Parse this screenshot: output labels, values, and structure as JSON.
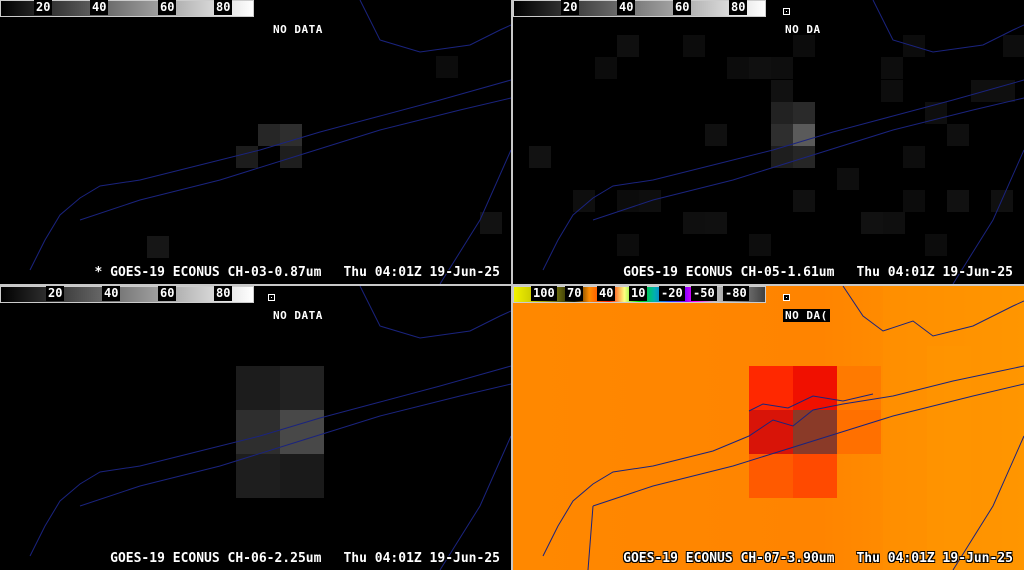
{
  "panels": [
    {
      "channel_caption": "* GOES-19 ECONUS CH-03-0.87um",
      "time_caption": "Thu 04:01Z 19-Jun-25",
      "no_data": "NO DATA",
      "colorbar_ticks": [
        "20",
        "40",
        "60",
        "80"
      ]
    },
    {
      "channel_caption": "GOES-19 ECONUS CH-05-1.61um",
      "time_caption": "Thu 04:01Z 19-Jun-25",
      "no_data": "NO DA",
      "colorbar_ticks": [
        "20",
        "40",
        "60",
        "80"
      ]
    },
    {
      "channel_caption": "GOES-19 ECONUS CH-06-2.25um",
      "time_caption": "Thu 04:01Z 19-Jun-25",
      "no_data": "NO DATA",
      "colorbar_ticks": [
        "20",
        "40",
        "60",
        "80"
      ]
    },
    {
      "channel_caption": "GOES-19 ECONUS CH-07-3.90um",
      "time_caption": "Thu 04:01Z 19-Jun-25",
      "no_data": "NO DA(",
      "colorbar_ticks": [
        "100",
        "70",
        "40",
        "10",
        "-20",
        "-50",
        "-80"
      ]
    }
  ],
  "colors": {
    "ir_background": "#ff8c00",
    "coastline": "#1a237e",
    "divider": "#c8c8c8"
  }
}
